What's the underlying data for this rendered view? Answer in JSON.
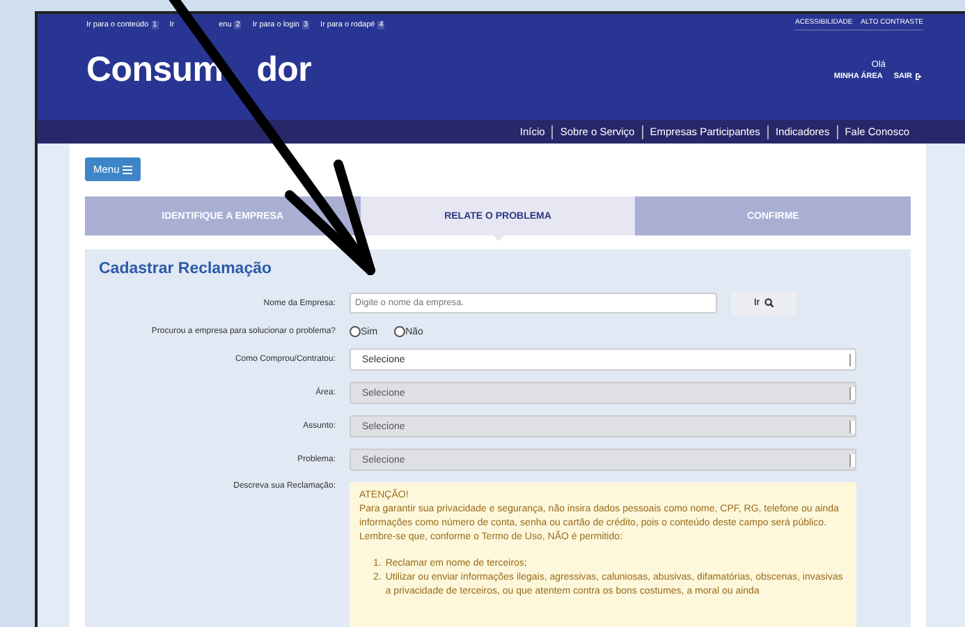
{
  "skip_links": [
    {
      "parts": [
        "Ir para o conteúdo"
      ],
      "key": "1"
    },
    {
      "parts": [
        "Ir",
        "enu"
      ],
      "key": "2"
    },
    {
      "parts": [
        "Ir para o login"
      ],
      "key": "3"
    },
    {
      "parts": [
        "Ir para o rodapé"
      ],
      "key": "4"
    }
  ],
  "accessibility_links": [
    "ACESSIBILIDADE",
    "ALTO CONTRASTE"
  ],
  "logo_parts": [
    "Consum",
    "dor"
  ],
  "user": {
    "greeting": "Olá",
    "my_area": "MINHA ÁREA",
    "logout": "SAIR"
  },
  "nav": [
    "Início",
    "Sobre o Serviço",
    "Empresas Participantes",
    "Indicadores",
    "Fale Conosco"
  ],
  "menu_button": "Menu",
  "steps": [
    {
      "label": "IDENTIFIQUE A EMPRESA",
      "selected": false
    },
    {
      "label": "RELATE O PROBLEMA",
      "selected": true
    },
    {
      "label": "CONFIRME",
      "selected": false
    }
  ],
  "form": {
    "title": "Cadastrar Reclamação",
    "fields": [
      {
        "kind": "text",
        "label": "Nome da Empresa:",
        "placeholder": "Digite o nome da empresa.",
        "button": "Ir"
      },
      {
        "kind": "radio",
        "label": "Procurou a empresa para solucionar o problema?",
        "options": [
          {
            "label": "Sim",
            "selected": false
          },
          {
            "label": "Não",
            "selected": false
          }
        ]
      },
      {
        "kind": "select",
        "label": "Como Comprou/Contratou:",
        "value": "Selecione",
        "disabled": false
      },
      {
        "kind": "select",
        "label": "Área:",
        "value": "Selecione",
        "disabled": true
      },
      {
        "kind": "select",
        "label": "Assunto:",
        "value": "Selecione",
        "disabled": true
      },
      {
        "kind": "select",
        "label": "Problema:",
        "value": "Selecione",
        "disabled": true
      },
      {
        "kind": "notice",
        "label": "Descreva sua Reclamação:",
        "heading": "ATENÇÃO!",
        "text": "Para garantir sua privacidade e segurança, não insira dados pessoais como nome, CPF, RG, telefone ou ainda informações como número de conta, senha ou cartão de crédito, pois o conteúdo deste campo será público. Lembre-se que, conforme o Termo de Uso, NÃO é permitido:",
        "items": [
          {
            "number": "1.",
            "text": "Reclamar em nome de terceiros;"
          },
          {
            "number": "2.",
            "text": "Utilizar ou enviar informações ilegais, agressivas, caluniosas, abusivas, difamatórias, obscenas, invasivas a privacidade de terceiros, ou que atentem contra os bons costumes, a moral ou ainda"
          }
        ]
      }
    ]
  }
}
